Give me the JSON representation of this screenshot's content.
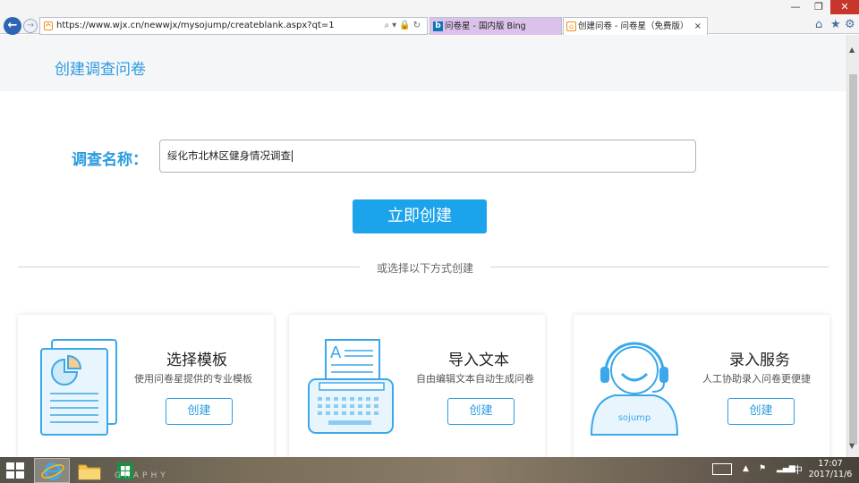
{
  "browser": {
    "url": "https://www.wjx.cn/newwjx/mysojump/createblank.aspx?qt=1",
    "tabs": [
      {
        "label": "问卷星 - 国内版 Bing"
      },
      {
        "label": "创建问卷 - 问卷星（免费版）"
      }
    ],
    "tab_close": "×"
  },
  "page": {
    "title": "创建调查问卷",
    "name_label": "调查名称：",
    "name_value": "绥化市北林区健身情况调查",
    "create_now": "立即创建",
    "divider_text": "或选择以下方式创建",
    "cards": [
      {
        "title": "选择模板",
        "desc": "使用问卷星提供的专业模板",
        "button": "创建",
        "icon": "template-document-icon"
      },
      {
        "title": "导入文本",
        "desc": "自由编辑文本自动生成问卷",
        "button": "创建",
        "icon": "typewriter-icon"
      },
      {
        "title": "录入服务",
        "desc": "人工协助录入问卷更便捷",
        "button": "创建",
        "icon": "headset-agent-icon",
        "badge": "sojump"
      }
    ]
  },
  "taskbar": {
    "clock_time": "17:07",
    "clock_date": "2017/11/6",
    "ime": "中",
    "watermark": "GRAPHY"
  },
  "colors": {
    "accent": "#1ba4ec",
    "accent_text": "#2b9ce0"
  }
}
